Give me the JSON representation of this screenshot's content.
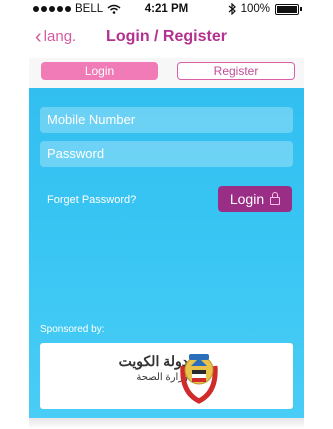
{
  "status": {
    "carrier": "BELL",
    "time": "4:21 PM",
    "battery": "100%"
  },
  "nav": {
    "back_label": "lang.",
    "title": "Login / Register"
  },
  "tabs": {
    "login": "Login",
    "register": "Register"
  },
  "form": {
    "mobile_placeholder": "Mobile Number",
    "password_placeholder": "Password",
    "forget_label": "Forget Password?",
    "login_button": "Login"
  },
  "sponsor": {
    "label": "Sponsored by:",
    "name_line1": "دولة الكويت",
    "name_line2": "وزارة الصحة"
  },
  "colors": {
    "accent": "#b5318f",
    "tab_active": "#f07bb7",
    "button": "#9a2d86",
    "background": "#3ac6f3"
  }
}
